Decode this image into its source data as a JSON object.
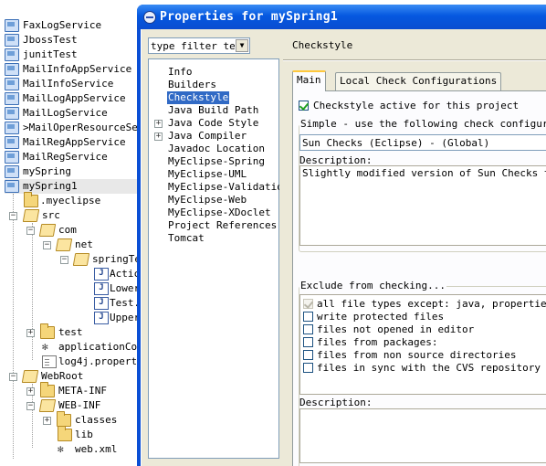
{
  "explorer": {
    "projects": [
      "FaxLogService",
      "JbossTest",
      "junitTest",
      "MailInfoAppService",
      "MailInfoService",
      "MailLogAppService",
      "MailLogService",
      ">MailOperResourceSet",
      "MailRegAppService",
      "MailRegService",
      "mySpring",
      "mySpring1"
    ],
    "tree": {
      "myeclipse": ".myeclipse",
      "src": "src",
      "com": "com",
      "net": "net",
      "springTest": "springTe",
      "java_files": [
        "Actic",
        "Lower",
        "Test.",
        "Upper"
      ],
      "test": "test",
      "applicationContext": "applicationCon",
      "log4j": "log4j.properti",
      "webroot": "WebRoot",
      "metainf": "META-INF",
      "webinf": "WEB-INF",
      "classes": "classes",
      "lib": "lib",
      "webxml": "web.xml"
    }
  },
  "dialog": {
    "title": "Properties for mySpring1",
    "filter_text": "type filter tex",
    "nav": [
      "Info",
      "Builders",
      "Checkstyle",
      "Java Build Path",
      "Java Code Style",
      "Java Compiler",
      "Javadoc Location",
      "MyEclipse-Spring",
      "MyEclipse-UML",
      "MyEclipse-Validation",
      "MyEclipse-Web",
      "MyEclipse-XDoclet",
      "Project References",
      "Tomcat"
    ],
    "nav_selected": "Checkstyle",
    "page_title": "Checkstyle",
    "tabs": [
      "Main",
      "Local Check Configurations"
    ],
    "active_label": "Checkstyle active for this project",
    "simple_group": "Simple - use the following check configuration",
    "config_value": "Sun Checks (Eclipse)  - (Global)",
    "description_label": "Description:",
    "description_text": "Slightly modified version of Sun Checks that better matches the default code formatter setting of Eclipse.",
    "exclude_group": "Exclude from checking...",
    "excludes": [
      {
        "label": "all file types except: java, properties",
        "checked": true
      },
      {
        "label": "write protected files",
        "checked": false
      },
      {
        "label": "files not opened in editor",
        "checked": false
      },
      {
        "label": "files from packages:",
        "checked": false
      },
      {
        "label": "files from non source directories",
        "checked": false
      },
      {
        "label": "files in sync with the CVS repository",
        "checked": false
      }
    ],
    "description_label_2": "Description:"
  },
  "colors": {
    "titlebar": "#0558e0",
    "selection": "#316ac5",
    "dialog_bg": "#ece9d8"
  }
}
